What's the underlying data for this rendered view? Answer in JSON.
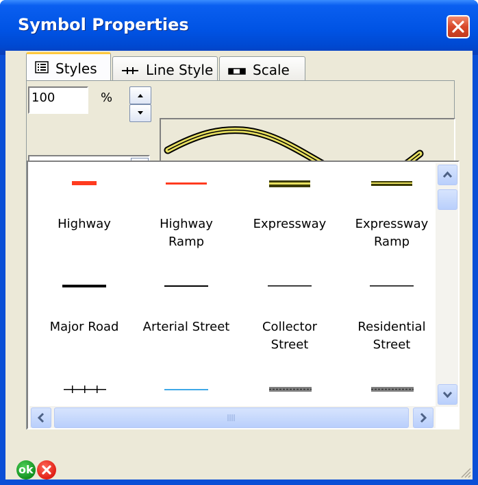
{
  "window": {
    "title": "Symbol Properties",
    "close_icon": "close-icon"
  },
  "tabs": [
    {
      "label": "Styles",
      "icon": "list-icon",
      "active": true
    },
    {
      "label": "Line Style",
      "icon": "line-style-icon",
      "active": false
    },
    {
      "label": "Scale",
      "icon": "scale-icon",
      "active": false
    }
  ],
  "controls": {
    "scale_value": "100",
    "percent_label": "%",
    "style_filter_value": "*"
  },
  "styles": [
    {
      "label": "Highway",
      "swatch_color": "#ff3b1f",
      "swatch_type": "thick"
    },
    {
      "label": "Highway Ramp",
      "swatch_color": "#ff3b1f",
      "swatch_type": "thin"
    },
    {
      "label": "Expressway",
      "swatch_color": "#3a3a00",
      "swatch_type": "double-yellow"
    },
    {
      "label": "Expressway Ramp",
      "swatch_color": "#3a3a00",
      "swatch_type": "double-yellow-thin"
    },
    {
      "label": "Major Road",
      "swatch_color": "#000000",
      "swatch_type": "thick"
    },
    {
      "label": "Arterial Street",
      "swatch_color": "#000000",
      "swatch_type": "thin"
    },
    {
      "label": "Collector Street",
      "swatch_color": "#000000",
      "swatch_type": "thin"
    },
    {
      "label": "Residential Street",
      "swatch_color": "#000000",
      "swatch_type": "thin"
    },
    {
      "label": "",
      "swatch_color": "#000000",
      "swatch_type": "railroad"
    },
    {
      "label": "",
      "swatch_color": "#3ea8e8",
      "swatch_type": "thin"
    },
    {
      "label": "",
      "swatch_color": "#808080",
      "swatch_type": "dashed-gray"
    },
    {
      "label": "",
      "swatch_color": "#808080",
      "swatch_type": "dashed-gray"
    }
  ],
  "footer": {
    "ok_label": "ok",
    "cancel_icon": "cancel-icon"
  },
  "colors": {
    "title_bar": "#0053e4",
    "dialog_face": "#ece9d8",
    "active_tab_highlight": "#ffc83c",
    "preview_line": "#e8e060"
  }
}
